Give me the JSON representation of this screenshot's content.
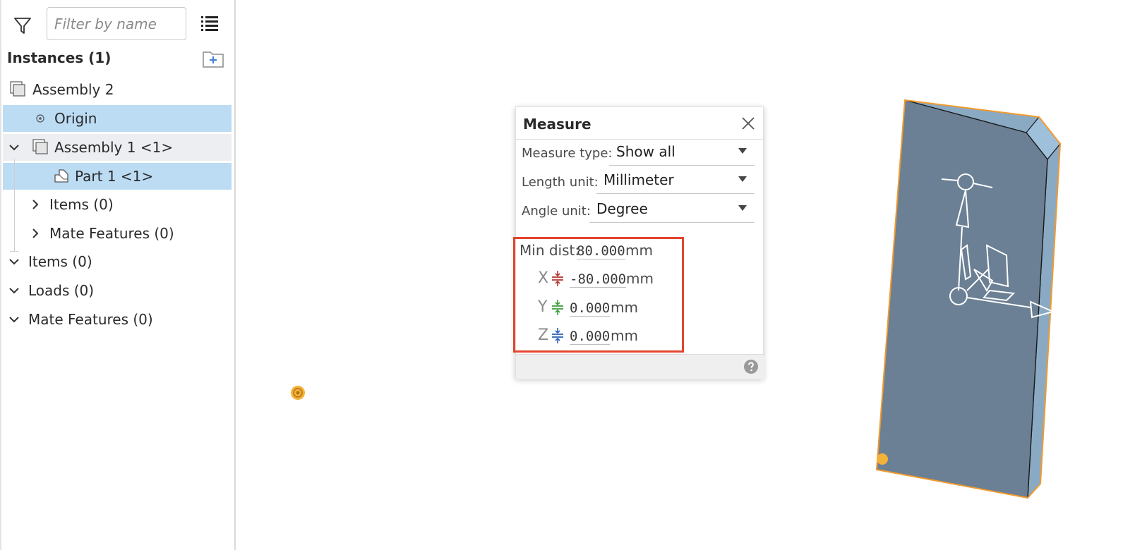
{
  "panel": {
    "filter_placeholder": "Filter by name",
    "instances_header": "Instances (1)"
  },
  "tree": {
    "assembly2": "Assembly 2",
    "origin": "Origin",
    "assembly1": "Assembly 1 <1>",
    "part1": "Part 1 <1>",
    "items_nested": "Items (0)",
    "mate_features_nested": "Mate Features (0)",
    "items": "Items (0)",
    "loads": "Loads (0)",
    "mate_features": "Mate Features (0)"
  },
  "measure": {
    "title": "Measure",
    "measure_type_label": "Measure type:",
    "measure_type_value": "Show all",
    "length_unit_label": "Length unit:",
    "length_unit_value": "Millimeter",
    "angle_unit_label": "Angle unit:",
    "angle_unit_value": "Degree",
    "min_dist_label": "Min dist:",
    "min_dist_value": "80.000",
    "x_label": "X",
    "x_value": "-80.000",
    "y_label": "Y",
    "y_value": "0.000",
    "z_label": "Z",
    "z_value": "0.000",
    "unit": "mm"
  },
  "colors": {
    "selection": "#bcdcf4",
    "highlight_box": "#e3452f",
    "part_face": "#6b8094",
    "part_edge": "#f29a2e",
    "x_axis": "#b5322c",
    "y_axis": "#3b9a35",
    "z_axis": "#2b5fb8"
  }
}
